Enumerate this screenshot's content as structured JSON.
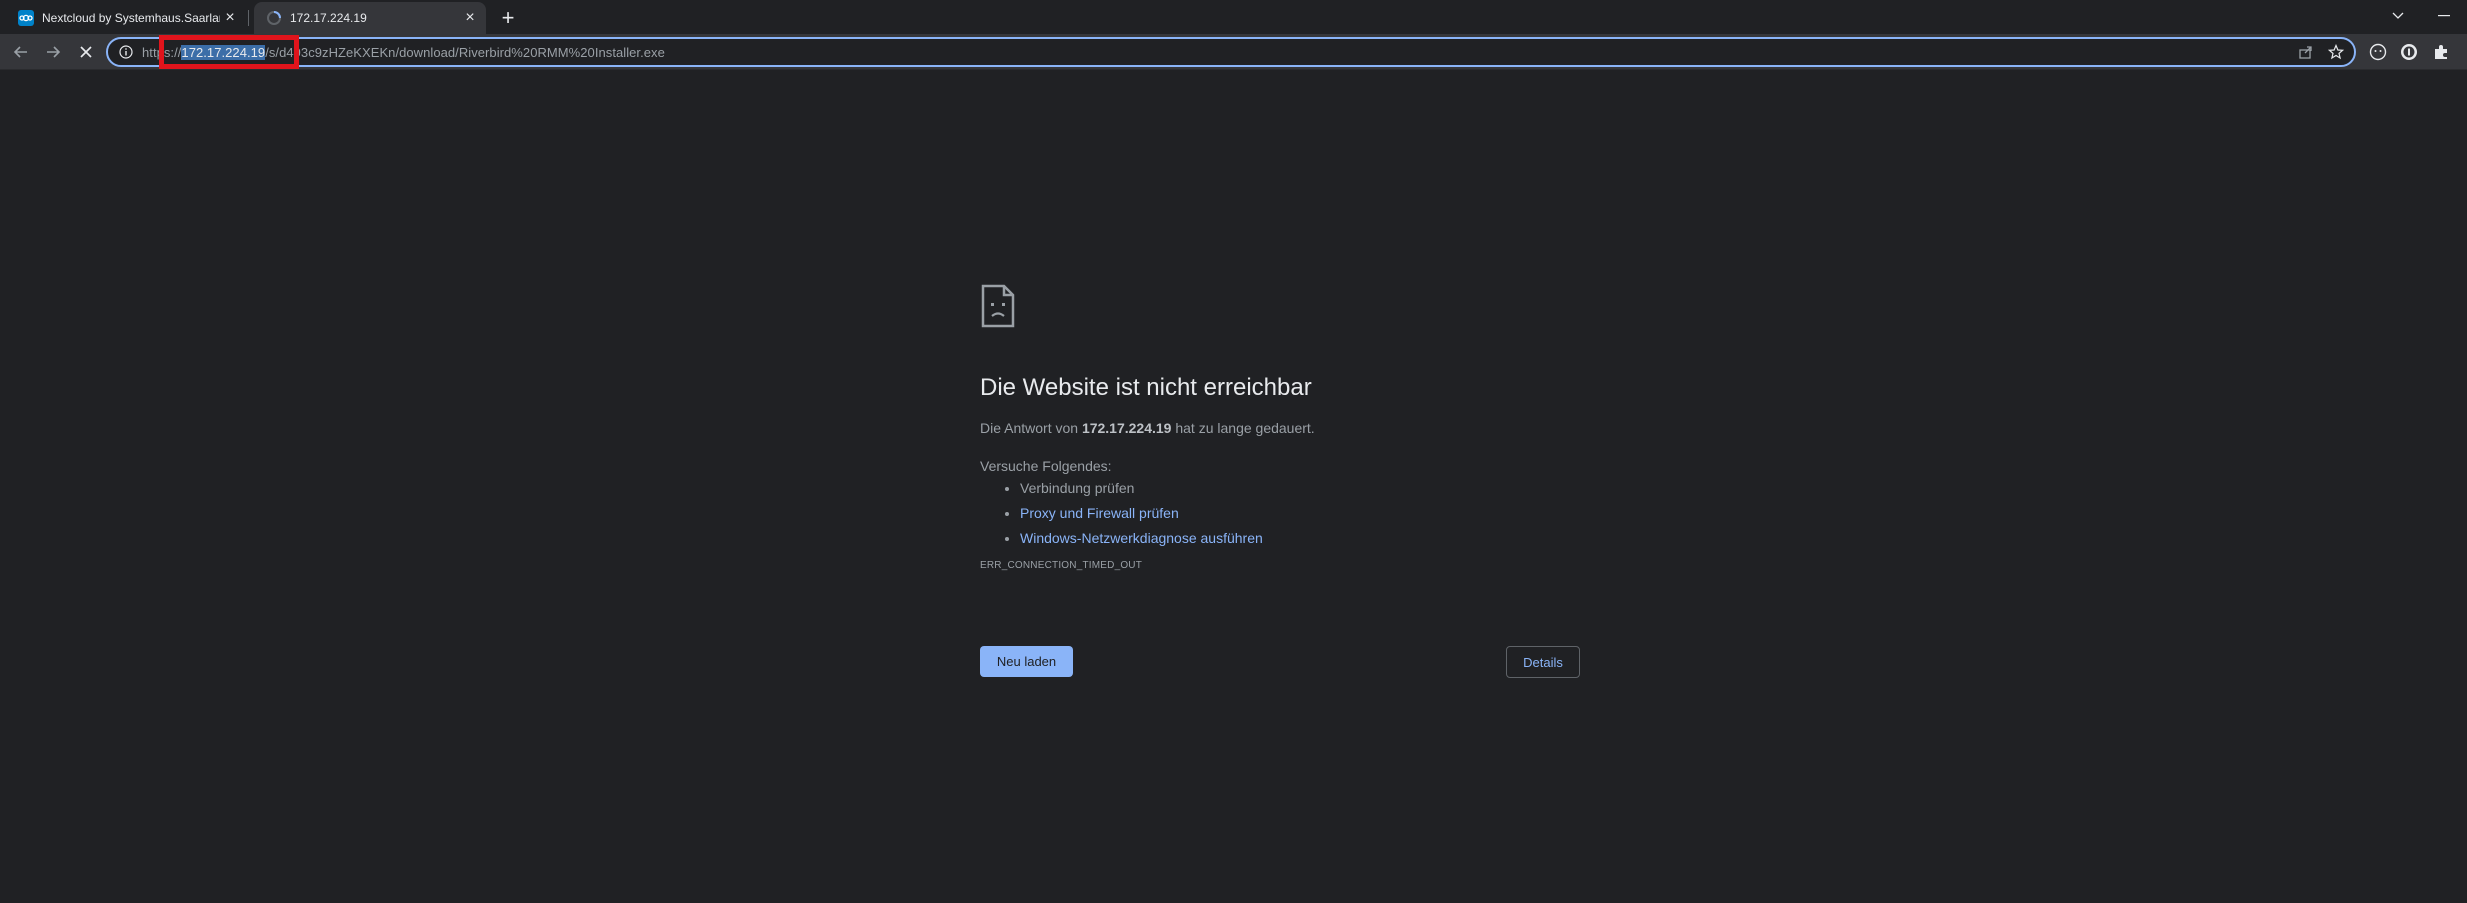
{
  "tabs": [
    {
      "title": "Nextcloud by Systemhaus.Saarland",
      "favicon": "nextcloud-icon",
      "active": false
    },
    {
      "title": "172.17.224.19",
      "favicon": "loading-spinner-icon",
      "active": true
    }
  ],
  "toolbar": {
    "url_scheme": "https://",
    "url_host": "172.17.224.19",
    "url_path": "/s/d493c9zHZeKXEKn/download/Riverbird%20RMM%20Installer.exe",
    "accent_color": "#8ab4f8",
    "annotation_color": "#e0141c"
  },
  "error": {
    "heading": "Die Website ist nicht erreichbar",
    "desc_prefix": "Die Antwort von ",
    "desc_host": "172.17.224.19",
    "desc_suffix": " hat zu lange gedauert.",
    "suggest_label": "Versuche Folgendes:",
    "suggestions": [
      {
        "text": "Verbindung prüfen",
        "link": false
      },
      {
        "text": "Proxy und Firewall prüfen",
        "link": true
      },
      {
        "text": "Windows-Netzwerkdiagnose ausführen",
        "link": true
      }
    ],
    "code": "ERR_CONNECTION_TIMED_OUT",
    "reload_label": "Neu laden",
    "details_label": "Details"
  }
}
